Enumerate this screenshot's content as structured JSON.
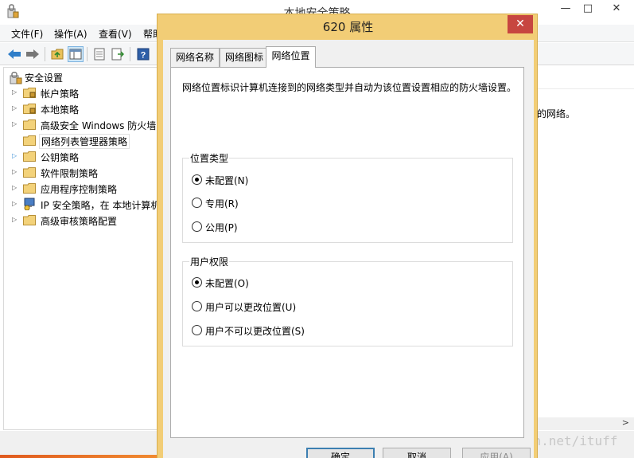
{
  "app": {
    "title": "本地安全策略"
  },
  "window_controls": {
    "minimize": "—",
    "maximize": "□",
    "close": "✕"
  },
  "menu": [
    "文件(F)",
    "操作(A)",
    "查看(V)",
    "帮助"
  ],
  "toolbar_icons": [
    "back-arrow-icon",
    "forward-arrow-icon",
    "up-folder-icon",
    "show-tree-icon",
    "export-list-icon",
    "properties-icon",
    "help-icon"
  ],
  "tree": [
    {
      "label": "安全设置",
      "icon": "security-settings-icon",
      "root": true
    },
    {
      "label": "帐户策略",
      "icon": "folder-lock-icon",
      "expander": "▷"
    },
    {
      "label": "本地策略",
      "icon": "folder-lock-icon",
      "expander": "▷"
    },
    {
      "label": "高级安全 Windows 防火墙",
      "icon": "folder-icon",
      "expander": "▷"
    },
    {
      "label": "网络列表管理器策略",
      "icon": "folder-icon",
      "expander": "",
      "selected": true
    },
    {
      "label": "公钥策略",
      "icon": "folder-icon",
      "expander": "▷"
    },
    {
      "label": "软件限制策略",
      "icon": "folder-icon",
      "expander": "▷"
    },
    {
      "label": "应用程序控制策略",
      "icon": "folder-icon",
      "expander": "▷"
    },
    {
      "label": "IP 安全策略，在 本地计算机",
      "icon": "ip-security-icon",
      "expander": "▷"
    },
    {
      "label": "高级审核策略配置",
      "icon": "folder-icon",
      "expander": "▷"
    }
  ],
  "right_pane": {
    "desc_fragment": "的网络。",
    "scroll_right": ">"
  },
  "watermark": "http://blog.csdn.net/ituff",
  "dialog": {
    "title": "620 属性",
    "close": "✕",
    "tabs": [
      "网络名称",
      "网络图标",
      "网络位置"
    ],
    "active_tab": 2,
    "description": "网络位置标识计算机连接到的网络类型并自动为该位置设置相应的防火墙设置。",
    "location_group": {
      "title": "位置类型",
      "options": [
        "未配置(N)",
        "专用(R)",
        "公用(P)"
      ],
      "selected": 0
    },
    "permission_group": {
      "title": "用户权限",
      "options": [
        "未配置(O)",
        "用户可以更改位置(U)",
        "用户不可以更改位置(S)"
      ],
      "selected": 0
    },
    "buttons": {
      "ok": "确定",
      "cancel": "取消",
      "apply": "应用(A)"
    }
  },
  "colors": {
    "dialog_frame": "#f2cd76",
    "close_button": "#c74640",
    "selection": "#cce8ff"
  }
}
